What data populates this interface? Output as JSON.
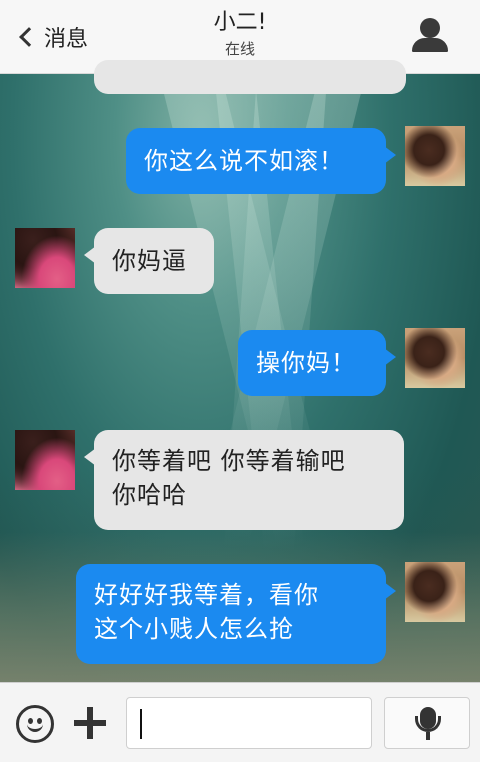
{
  "header": {
    "back_label": "消息",
    "title": "小二!",
    "status": "在线"
  },
  "messages": [
    {
      "from": "me",
      "text": "你这么说不如滚！"
    },
    {
      "from": "friend",
      "text": "你妈逼"
    },
    {
      "from": "me",
      "text": "操你妈！"
    },
    {
      "from": "friend",
      "line1": "你等着吧 你等着输吧",
      "line2": "你哈哈"
    },
    {
      "from": "me",
      "line1": "好好好我等着，看你",
      "line2": "这个小贱人怎么抢"
    }
  ],
  "input_bar": {
    "input_value": "",
    "icons": [
      "emoji-icon",
      "plus-icon",
      "microphone-icon"
    ]
  },
  "colors": {
    "outgoing_bubble": "#1b8af0",
    "incoming_bubble": "#e6e6e6",
    "header_bg": "#f7f7f7"
  }
}
